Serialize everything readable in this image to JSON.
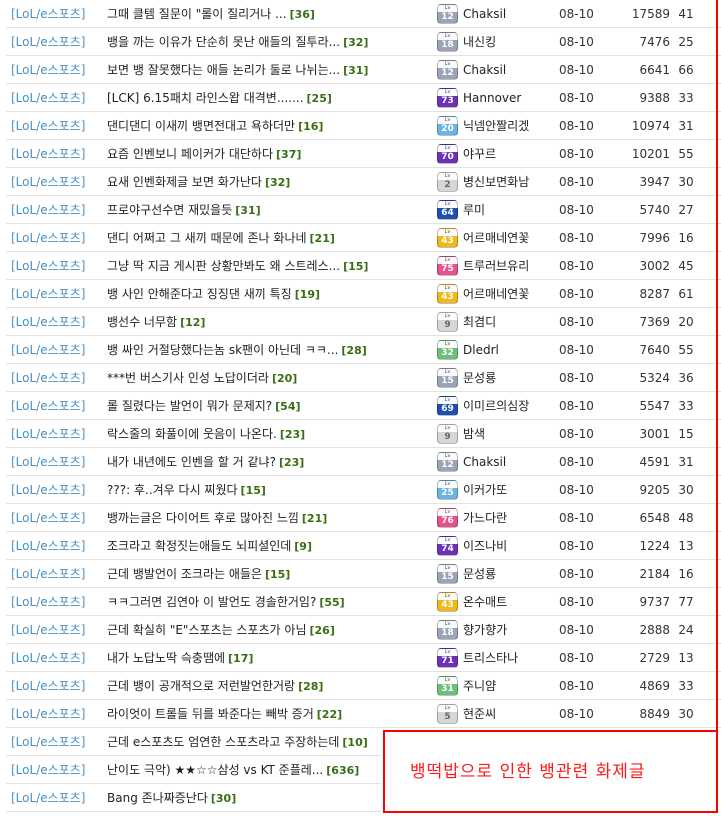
{
  "annotation": "뱅떡밥으로 인한 뱅관련 화제글",
  "colors": {
    "category": "#4a90c4",
    "comment_count": "#3a6e12",
    "annotation_border": "#ff0000"
  },
  "rows": [
    {
      "category": "[LoL/e스포츠]",
      "title": "그때 클템 질문이 \"롤이 질리거나 ...",
      "comments": "[36]",
      "level": "12",
      "author": "Chaksil",
      "date": "08-10",
      "views": "17589",
      "rec": "41"
    },
    {
      "category": "[LoL/e스포츠]",
      "title": "뱅을 까는 이유가 단순히 못난 애들의 질투라...",
      "comments": "[32]",
      "level": "18",
      "author": "내신킹",
      "date": "08-10",
      "views": "7476",
      "rec": "25"
    },
    {
      "category": "[LoL/e스포츠]",
      "title": "보면 뱅 잘못했다는 애들 논리가 둘로 나뉘는...",
      "comments": "[31]",
      "level": "12",
      "author": "Chaksil",
      "date": "08-10",
      "views": "6641",
      "rec": "66"
    },
    {
      "category": "[LoL/e스포츠]",
      "title": "[LCK] 6.15패치 라인스왑 대격변.......",
      "comments": "[25]",
      "level": "73",
      "author": "Hannover",
      "date": "08-10",
      "views": "9388",
      "rec": "33"
    },
    {
      "category": "[LoL/e스포츠]",
      "title": "댄디댄디 이새끼 뱅면전대고 욕하더만",
      "comments": "[16]",
      "level": "20",
      "author": "닉넴안짤리겠",
      "date": "08-10",
      "views": "10974",
      "rec": "31"
    },
    {
      "category": "[LoL/e스포츠]",
      "title": "요즘 인벤보니 페이커가 대단하다",
      "comments": "[37]",
      "level": "70",
      "author": "야꾸르",
      "date": "08-10",
      "views": "10201",
      "rec": "55"
    },
    {
      "category": "[LoL/e스포츠]",
      "title": "요새 인벤화제글 보면 화가난다",
      "comments": "[32]",
      "level": "2",
      "author": "병신보면화남",
      "date": "08-10",
      "views": "3947",
      "rec": "30"
    },
    {
      "category": "[LoL/e스포츠]",
      "title": "프로야구선수면 재밌을듯",
      "comments": "[31]",
      "level": "64",
      "author": "루미",
      "date": "08-10",
      "views": "5740",
      "rec": "27"
    },
    {
      "category": "[LoL/e스포츠]",
      "title": "댄디 어쩌고 그 새끼 때문에 존나 화나네",
      "comments": "[21]",
      "level": "43",
      "author": "어르매네연꽃",
      "date": "08-10",
      "views": "7996",
      "rec": "16"
    },
    {
      "category": "[LoL/e스포츠]",
      "title": "그냥 딱 지금 게시판 상황만봐도 왜 스트레스...",
      "comments": "[15]",
      "level": "75",
      "author": "트루러브유리",
      "date": "08-10",
      "views": "3002",
      "rec": "45"
    },
    {
      "category": "[LoL/e스포츠]",
      "title": "뱅 사인 안해준다고 징징댄 새끼 특징",
      "comments": "[19]",
      "level": "43",
      "author": "어르매네연꽃",
      "date": "08-10",
      "views": "8287",
      "rec": "61"
    },
    {
      "category": "[LoL/e스포츠]",
      "title": "뱅선수 너무함",
      "comments": "[12]",
      "level": "9",
      "author": "최겸디",
      "date": "08-10",
      "views": "7369",
      "rec": "20"
    },
    {
      "category": "[LoL/e스포츠]",
      "title": "뱅 싸인 거절당했다는놈 sk팬이 아닌데 ㅋㅋ...",
      "comments": "[28]",
      "level": "32",
      "author": "Dledrl",
      "date": "08-10",
      "views": "7640",
      "rec": "55"
    },
    {
      "category": "[LoL/e스포츠]",
      "title": "***번 버스기사 인성 노답이더라",
      "comments": "[20]",
      "level": "15",
      "author": "문성룡",
      "date": "08-10",
      "views": "5324",
      "rec": "36"
    },
    {
      "category": "[LoL/e스포츠]",
      "title": "롤 질렸다는 발언이 뭐가 문제지?",
      "comments": "[54]",
      "level": "69",
      "author": "이미르의심장",
      "date": "08-10",
      "views": "5547",
      "rec": "33"
    },
    {
      "category": "[LoL/e스포츠]",
      "title": "락스줄의 화풀이에 웃음이 나온다.",
      "comments": "[23]",
      "level": "9",
      "author": "밤색",
      "date": "08-10",
      "views": "3001",
      "rec": "15"
    },
    {
      "category": "[LoL/e스포츠]",
      "title": "내가 내년에도 인벤을 할 거 같냐?",
      "comments": "[23]",
      "level": "12",
      "author": "Chaksil",
      "date": "08-10",
      "views": "4591",
      "rec": "31"
    },
    {
      "category": "[LoL/e스포츠]",
      "title": "???: 후..겨우 다시 찌웠다",
      "comments": "[15]",
      "level": "25",
      "author": "이커가또",
      "date": "08-10",
      "views": "9205",
      "rec": "30"
    },
    {
      "category": "[LoL/e스포츠]",
      "title": "뱅까는글은 다이어트 후로 많아진 느낌",
      "comments": "[21]",
      "level": "76",
      "author": "가느다란",
      "date": "08-10",
      "views": "6548",
      "rec": "48"
    },
    {
      "category": "[LoL/e스포츠]",
      "title": "조크라고 확정짓는애들도 뇌피셜인데",
      "comments": "[9]",
      "level": "74",
      "author": "이즈나비",
      "date": "08-10",
      "views": "1224",
      "rec": "13"
    },
    {
      "category": "[LoL/e스포츠]",
      "title": "근데 뱅발언이 조크라는 애들은",
      "comments": "[15]",
      "level": "15",
      "author": "문성룡",
      "date": "08-10",
      "views": "2184",
      "rec": "16"
    },
    {
      "category": "[LoL/e스포츠]",
      "title": "ㅋㅋ그러면 김연아 이 발언도 경솔한거임?",
      "comments": "[55]",
      "level": "43",
      "author": "온수매트",
      "date": "08-10",
      "views": "9737",
      "rec": "77"
    },
    {
      "category": "[LoL/e스포츠]",
      "title": "근데 확실히 \"E\"스포츠는 스포츠가 아님",
      "comments": "[26]",
      "level": "18",
      "author": "향가향가",
      "date": "08-10",
      "views": "2888",
      "rec": "24"
    },
    {
      "category": "[LoL/e스포츠]",
      "title": "내가 노답노딱 슥충땜에",
      "comments": "[17]",
      "level": "71",
      "author": "트리스타나",
      "date": "08-10",
      "views": "2729",
      "rec": "13"
    },
    {
      "category": "[LoL/e스포츠]",
      "title": "근데 뱅이 공개적으로 저런발언한거랑",
      "comments": "[28]",
      "level": "31",
      "author": "주니얌",
      "date": "08-10",
      "views": "4869",
      "rec": "33"
    },
    {
      "category": "[LoL/e스포츠]",
      "title": "라이엇이 트롤들 뒤를 봐준다는 빼박 증거",
      "comments": "[22]",
      "level": "5",
      "author": "현준씨",
      "date": "08-10",
      "views": "8849",
      "rec": "30"
    },
    {
      "category": "[LoL/e스포츠]",
      "title": "근데 e스포츠도 엄연한 스포츠라고 주장하는데",
      "comments": "[10]"
    },
    {
      "category": "[LoL/e스포츠]",
      "title": "난이도 극악) ★★☆☆삼성 vs KT 준플레...",
      "comments": "[636]"
    },
    {
      "category": "[LoL/e스포츠]",
      "title": "Bang 존나짜증난다",
      "comments": "[30]"
    }
  ]
}
